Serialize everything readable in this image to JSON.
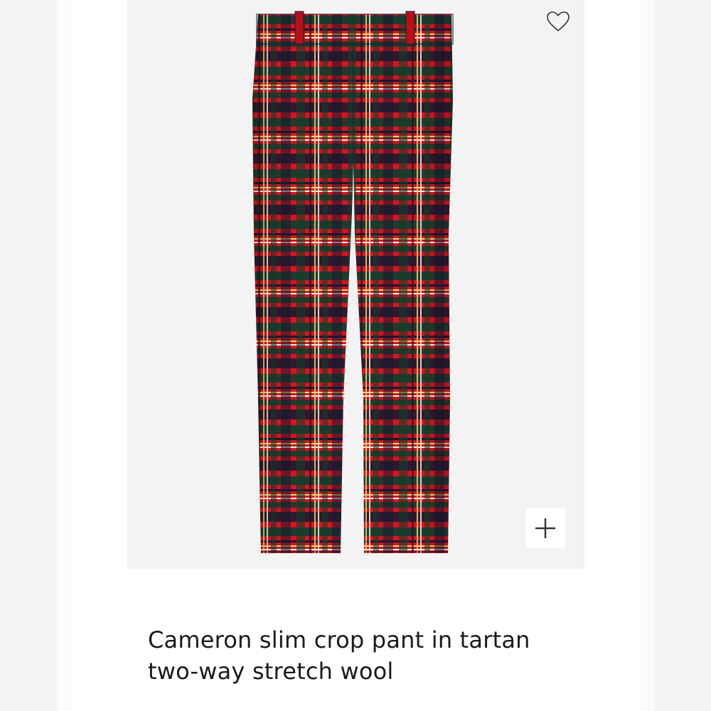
{
  "product": {
    "title_line_1": "Cameron slim crop pant in tartan",
    "title_line_2": "two-way stretch wool",
    "image_alt": "Red tartan plaid slim crop pants"
  },
  "icons": {
    "wishlist": "heart-outline-icon",
    "zoom": "plus-icon"
  },
  "colors": {
    "image_background": "#f3f3f3",
    "tartan_red": "#d8141e",
    "tartan_green": "#0f3d2c",
    "tartan_navy": "#141a30",
    "tartan_yellow": "#e9d76a",
    "text": "#1a1a1a"
  }
}
